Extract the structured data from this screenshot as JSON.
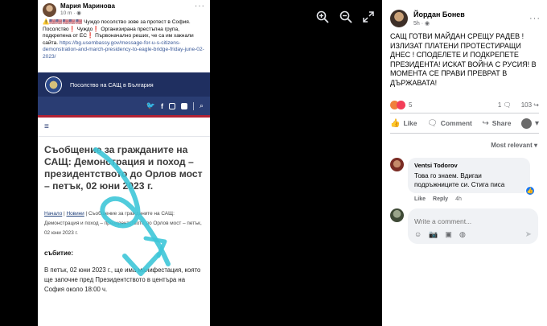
{
  "embedded_post": {
    "author": "Мария Маринова",
    "time": "10 m · ◉",
    "text_prefix": "⚠️🇺🇸🇺🇸🇺🇸🇺🇸🇺🇸 Чуждо посолство зове за протест в София. Посолство❗ Чуждо❗ Организирана престъпна група, подкрепена от ЕС❗ Първоначално реших, че са им хакнали сайта. ",
    "link": "https://bg.usembassy.gov/message-for-u-s-citizens-demonstration-and-march-presidency-to-eagle-bridge-friday-june-02-2023/",
    "embassy_title": "Посолство на САЩ в България",
    "social_icons": [
      "twitter-icon",
      "facebook-icon",
      "instagram-icon",
      "plus-icon",
      "search-icon"
    ],
    "menu_icon": "≡",
    "heading": "Съобщение за гражданите на САЩ: Демонстрация и поход – президентството до Орлов мост – петък, 02 юни 2023 г.",
    "breadcrumb_home": "Начало",
    "breadcrumb_news": "Новини",
    "breadcrumb_rest": " | Съобщение за гражданите на САЩ: Демонстрация и поход – президентството до Орлов мост – петък, 02 юни 2023 г.",
    "section": "събитие:",
    "body": "В петък, 02 юни 2023 г., ще има манифестация, която ще започне пред Президентството в центъра на София около 18:00 ч."
  },
  "toolbar": {
    "icons": [
      "zoom-in-icon",
      "zoom-out-icon",
      "fullscreen-icon"
    ]
  },
  "post": {
    "author": "Йордан Бонев",
    "time": "5h · ◉",
    "text": "САЩ ГОТВИ МАЙДАН СРЕЩУ РАДЕВ ! ИЗЛИЗАТ ПЛАТЕНИ ПРОТЕСТИРАЩИ ДНЕС ! СПОДЕЛЕТЕ И ПОДКРЕПЕТЕ ПРЕЗИДЕНТА! ИСКАТ ВОЙНА С РУСИЯ! В МОМЕНТА СЕ ПРАВИ ПРЕВРАТ В ДЪРЖАВАТА!",
    "reaction_count": "5",
    "comment_count": "1",
    "share_count": "103",
    "like_label": "Like",
    "comment_label": "Comment",
    "share_label": "Share",
    "sort_label": "Most relevant ▾"
  },
  "comment": {
    "author": "Ventsi Todorov",
    "text": "Това го знаем. Вдигаи подръжниците си. Стига писа",
    "like": "Like",
    "reply": "Reply",
    "time": "4h",
    "like_badge": "👍"
  },
  "composer": {
    "placeholder": "Write a comment..."
  },
  "colors": {
    "accent": "#1877f2",
    "embassy_blue": "#1f2f60",
    "scribble": "#3ec7d8"
  }
}
